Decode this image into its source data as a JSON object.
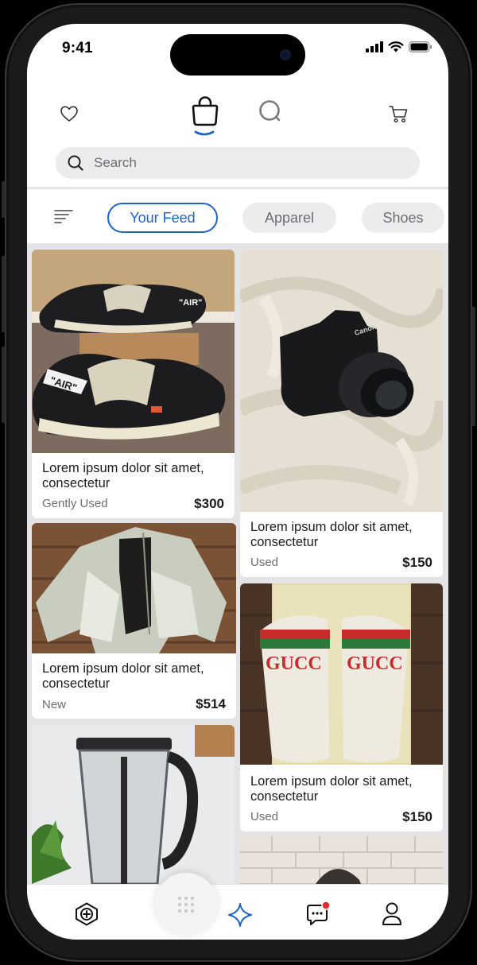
{
  "status_bar": {
    "time": "9:41"
  },
  "search": {
    "placeholder": "Search",
    "value": ""
  },
  "filters": {
    "chips": [
      {
        "label": "Your Feed",
        "active": true
      },
      {
        "label": "Apparel",
        "active": false
      },
      {
        "label": "Shoes",
        "active": false
      }
    ]
  },
  "listings": [
    {
      "title": "Lorem ipsum dolor sit amet, consectetur",
      "condition": "Gently Used",
      "price": "$300",
      "image": "sneakers"
    },
    {
      "title": "Lorem ipsum dolor sit amet, consectetur",
      "condition": "Used",
      "price": "$150",
      "image": "camera"
    },
    {
      "title": "Lorem ipsum dolor sit amet, consectetur",
      "condition": "New",
      "price": "$514",
      "image": "jacket"
    },
    {
      "title": "Lorem ipsum dolor sit amet, consectetur",
      "condition": "Used",
      "price": "$150",
      "image": "slides"
    },
    {
      "title": "",
      "condition": "",
      "price": "",
      "image": "blender"
    },
    {
      "title": "",
      "condition": "",
      "price": "",
      "image": "brick-wall-item"
    }
  ],
  "colors": {
    "accent": "#1f63c6",
    "chip_bg": "#ececef",
    "notification": "#e0282e"
  },
  "icons": {
    "top_nav": [
      "heart-icon",
      "shopping-bag-icon",
      "circle-search-icon",
      "cart-icon"
    ],
    "bottom_nav": [
      "add-listing-icon",
      "grid-dots-icon",
      "sparkle-icon",
      "messages-icon",
      "profile-icon"
    ]
  }
}
